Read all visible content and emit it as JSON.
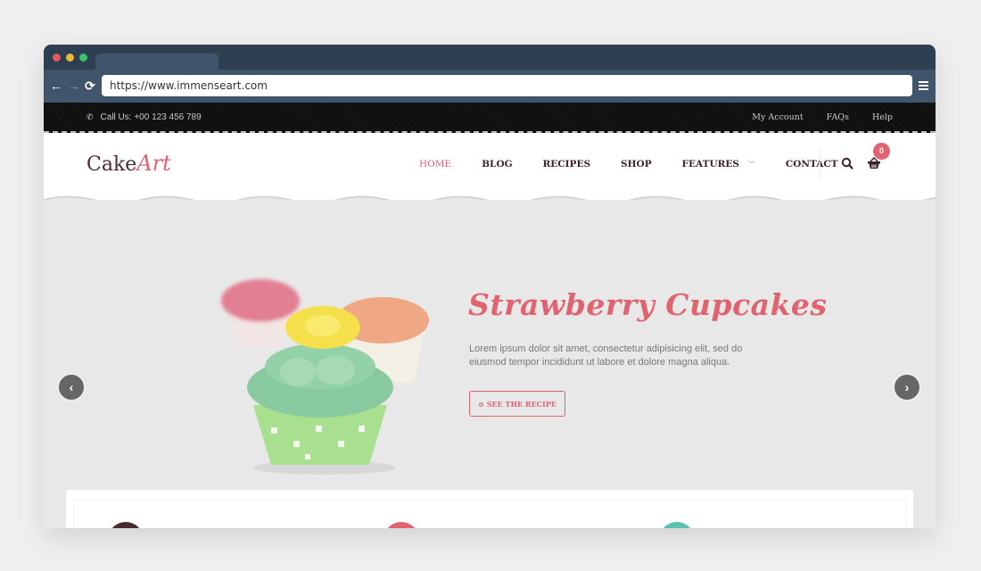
{
  "browser": {
    "url": "https://www.immenseart.com",
    "nav": {
      "back": "←",
      "forward": "→",
      "reload": "⟳"
    }
  },
  "topbar": {
    "phone": "Call Us: +00 123 456 789",
    "links": [
      "My Account",
      "FAQs",
      "Help"
    ]
  },
  "header": {
    "logo_main": "Cake",
    "logo_accent": "Art",
    "nav": [
      {
        "label": "HOME",
        "active": true
      },
      {
        "label": "BLOG"
      },
      {
        "label": "RECIPES"
      },
      {
        "label": "SHOP"
      },
      {
        "label": "FEATURES",
        "has_dropdown": true
      },
      {
        "label": "CONTACT"
      }
    ],
    "cart_count": "0"
  },
  "hero": {
    "title": "Strawberry Cupcakes",
    "text": "Lorem ipsum dolor sit amet, consectetur adipisicing elit, sed do eiusmod tempor incididunt ut labore et dolore magna aliqua.",
    "button": "SEE THE RECIPE",
    "button_icon": "⊙",
    "prev": "‹",
    "next": "›"
  },
  "colors": {
    "accent": "#e1636f",
    "brand_dark": "#4a2c2e",
    "teal": "#5ec1b0",
    "chrome": "#2e3f52"
  }
}
